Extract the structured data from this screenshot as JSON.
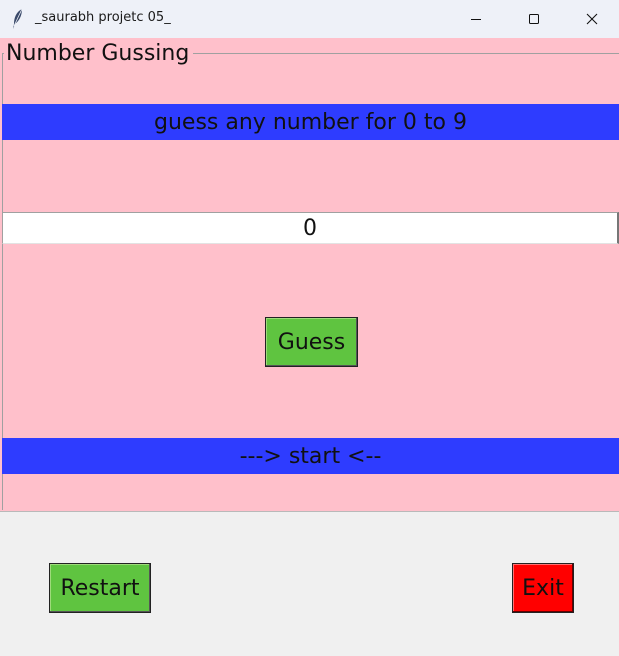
{
  "window": {
    "title": "_saurabh projetc 05_"
  },
  "frame": {
    "label": "Number Gussing",
    "background_color": "#ffc0cb"
  },
  "prompt_banner": {
    "text": "guess any number for 0 to 9",
    "background_color": "#2e3cff"
  },
  "entry": {
    "value": "0"
  },
  "guess_button": {
    "label": "Guess",
    "background_color": "#5fc440"
  },
  "status_banner": {
    "text": "---> start <--",
    "background_color": "#2e3cff"
  },
  "restart_button": {
    "label": "Restart",
    "background_color": "#5fc440"
  },
  "exit_button": {
    "label": "Exit",
    "background_color": "#ff0000"
  },
  "icons": {
    "app": "feather-icon",
    "minimize": "minimize-icon",
    "maximize": "maximize-icon",
    "close": "close-icon"
  }
}
